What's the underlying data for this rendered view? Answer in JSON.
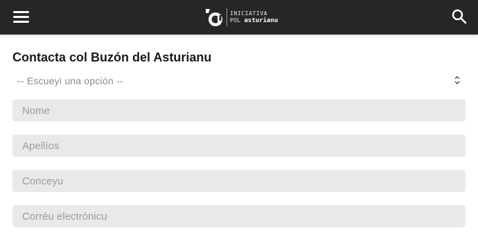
{
  "header": {
    "menu_icon": "hamburger-menu-icon",
    "logo": {
      "line1": "INICIATIVA",
      "line2_prefix": "POL",
      "line2_bold": "asturianu"
    },
    "search_icon": "search-icon",
    "background_color": "#262626"
  },
  "form": {
    "title": "Contacta col Buzón del Asturianu",
    "select": {
      "selected_value": "-- Escueyi una opción --",
      "icon": "up-down-chevron-icon"
    },
    "fields": [
      {
        "placeholder": "Nome"
      },
      {
        "placeholder": "Apellíos"
      },
      {
        "placeholder": "Conceyu"
      },
      {
        "placeholder": "Corréu electrónicu"
      }
    ],
    "field_background": "#e9e9eb"
  }
}
